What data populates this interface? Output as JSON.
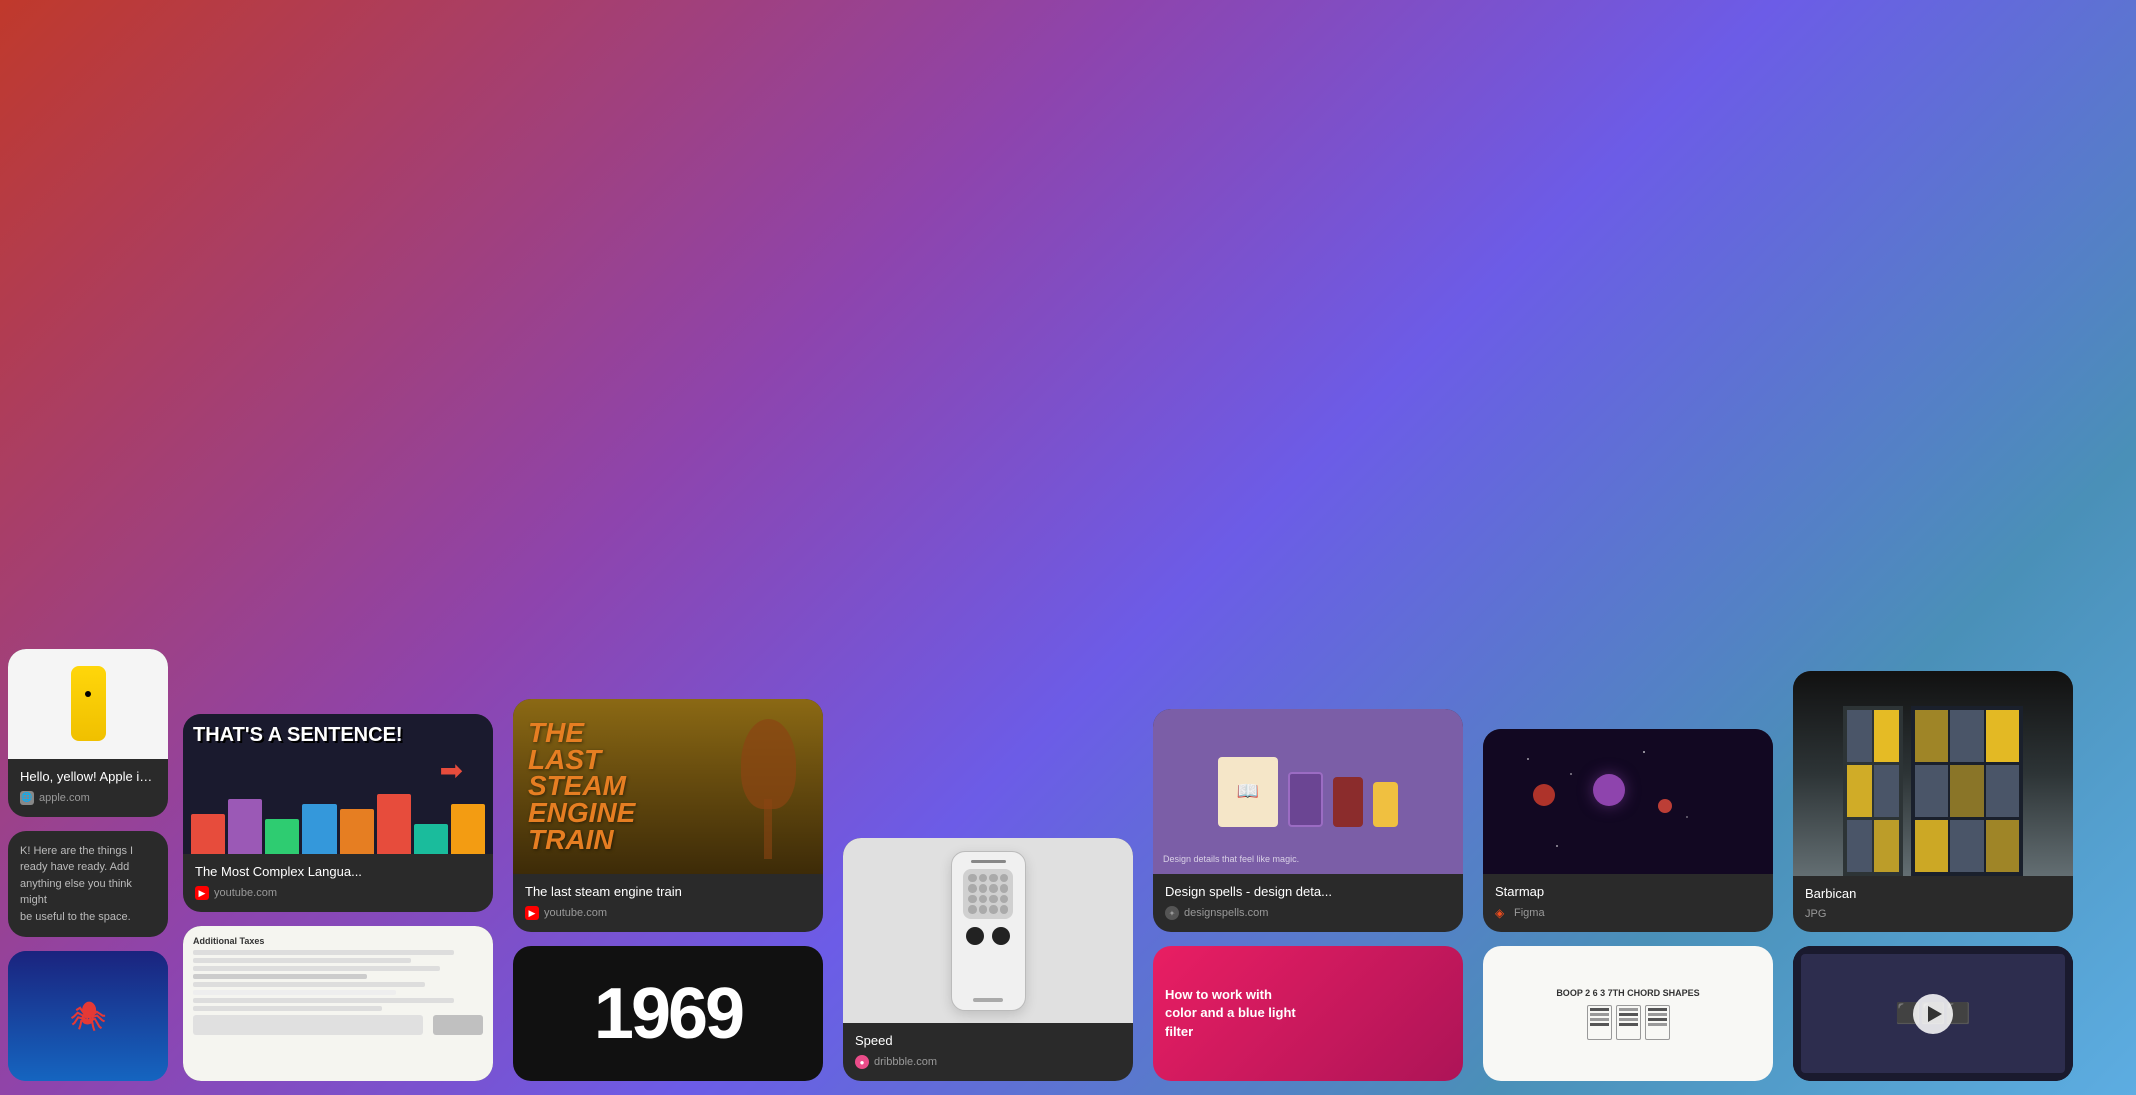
{
  "background": {
    "gradient": "red-purple-blue"
  },
  "cards": [
    {
      "id": "apple",
      "type": "partial-left",
      "title": "Hello, yellow! Apple introd...",
      "source": "apple.com",
      "source_icon": "globe",
      "thumbnail_type": "apple-phone",
      "description": "K! Here are the things I ready have ready. Add anything else you think might be useful to the space."
    },
    {
      "id": "sentence",
      "title": "The Most Complex Langua...",
      "source": "youtube.com",
      "source_icon": "youtube",
      "thumbnail_type": "sentence",
      "thumbnail_text": "THAT'S A SENTENCE!"
    },
    {
      "id": "spider",
      "title": "Spider-Man",
      "source": "",
      "thumbnail_type": "spider"
    },
    {
      "id": "train",
      "title": "The last steam engine train",
      "source": "youtube.com",
      "source_icon": "youtube",
      "thumbnail_type": "train",
      "thumbnail_title": "THE LAST STEAM ENGINE TRAIN"
    },
    {
      "id": "tax",
      "title": "Additional Taxes",
      "source": "",
      "thumbnail_type": "tax"
    },
    {
      "id": "speed",
      "title": "Speed",
      "source": "dribbble.com",
      "source_icon": "dribbble",
      "thumbnail_type": "speed"
    },
    {
      "id": "1969",
      "title": "1969",
      "source": "",
      "thumbnail_type": "1969"
    },
    {
      "id": "design",
      "title": "Design spells - design deta...",
      "source": "designspells.com",
      "source_icon": "globe",
      "thumbnail_type": "design"
    },
    {
      "id": "howto",
      "title": "How to work with color and a blue light filter",
      "source": "",
      "thumbnail_type": "howto"
    },
    {
      "id": "starmap",
      "title": "Starmap",
      "source": "Figma",
      "source_icon": "figma",
      "thumbnail_type": "starmap"
    },
    {
      "id": "chords",
      "title": "BOOP 2 6 3 7TH CHORD SHAPES",
      "source": "",
      "thumbnail_type": "chords"
    },
    {
      "id": "barbican",
      "title": "Barbican",
      "source": "JPG",
      "source_icon": "image",
      "thumbnail_type": "barbican"
    },
    {
      "id": "video",
      "title": "Video",
      "source": "",
      "thumbnail_type": "video"
    }
  ]
}
